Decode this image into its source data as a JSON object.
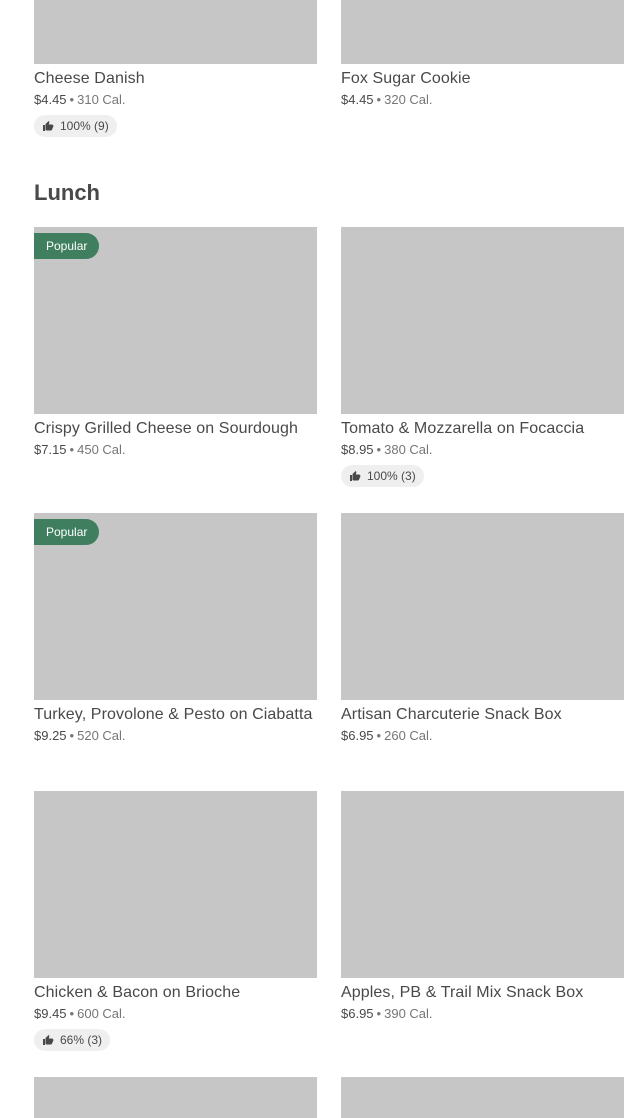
{
  "top_items": [
    {
      "name": "Cheese Danish",
      "price": "$4.45",
      "calories": "310 Cal.",
      "rating": "100% (9)"
    },
    {
      "name": "Fox Sugar Cookie",
      "price": "$4.45",
      "calories": "320 Cal."
    }
  ],
  "section": {
    "title": "Lunch"
  },
  "lunch_items": [
    {
      "name": "Crispy Grilled Cheese on Sourdough",
      "price": "$7.15",
      "calories": "450 Cal.",
      "badge": "Popular"
    },
    {
      "name": "Tomato & Mozzarella on Focaccia",
      "price": "$8.95",
      "calories": "380 Cal.",
      "rating": "100% (3)"
    },
    {
      "name": "Turkey, Provolone & Pesto on Ciabatta",
      "price": "$9.25",
      "calories": "520 Cal.",
      "badge": "Popular"
    },
    {
      "name": "Artisan Charcuterie Snack Box",
      "price": "$6.95",
      "calories": "260 Cal."
    },
    {
      "name": "Chicken & Bacon on Brioche",
      "price": "$9.45",
      "calories": "600 Cal.",
      "rating": "66% (3)"
    },
    {
      "name": "Apples, PB & Trail Mix Snack Box",
      "price": "$6.95",
      "calories": "390 Cal."
    }
  ],
  "separator": "•",
  "icons": {
    "rating": "thumbs-up-icon"
  },
  "colors": {
    "badge": "#3f7e5e",
    "image_placeholder": "#c6c6c6",
    "rating_pill": "#efefef"
  }
}
